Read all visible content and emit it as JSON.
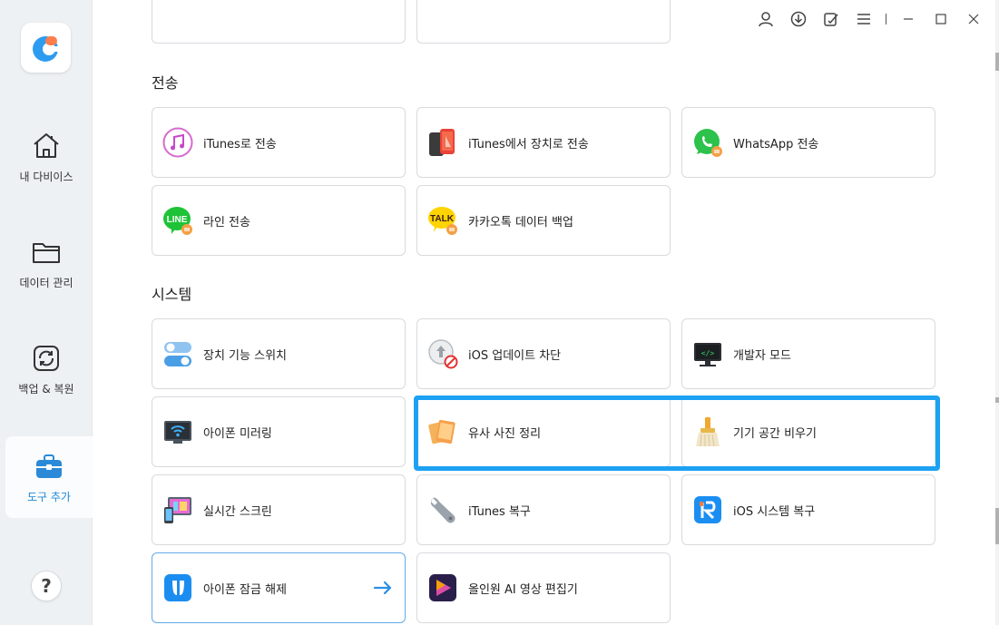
{
  "sidebar": {
    "items": [
      {
        "label": "내 다비이스",
        "icon": "home-icon"
      },
      {
        "label": "데이터 관리",
        "icon": "folder-icon"
      },
      {
        "label": "백업 & 복원",
        "icon": "backup-restore-icon"
      },
      {
        "label": "도구 추가",
        "icon": "toolbox-icon",
        "active": true
      }
    ],
    "help_label": "?"
  },
  "window": {
    "controls": [
      "account-icon",
      "download-icon",
      "feedback-icon",
      "menu-icon",
      "minimize-icon",
      "maximize-icon",
      "close-icon"
    ]
  },
  "sections": {
    "transfer": {
      "title": "전송",
      "cards": [
        {
          "label": "iTunes로 전송",
          "icon": "itunes-icon"
        },
        {
          "label": "iTunes에서 장치로 전송",
          "icon": "itunes-device-icon"
        },
        {
          "label": "WhatsApp 전송",
          "icon": "whatsapp-icon"
        },
        {
          "label": "라인 전송",
          "icon": "line-icon"
        },
        {
          "label": "카카오톡 데이터 백업",
          "icon": "kakaotalk-icon"
        }
      ]
    },
    "system": {
      "title": "시스템",
      "cards": [
        {
          "label": "장치 기능 스위치",
          "icon": "toggle-switch-icon"
        },
        {
          "label": "iOS 업데이트 차단",
          "icon": "update-block-icon"
        },
        {
          "label": "개발자 모드",
          "icon": "developer-icon"
        },
        {
          "label": "아이폰 미러링",
          "icon": "mirroring-icon"
        },
        {
          "label": "유사 사진 정리",
          "icon": "photos-icon"
        },
        {
          "label": "기기 공간 비우기",
          "icon": "broom-icon"
        },
        {
          "label": "실시간 스크린",
          "icon": "realtime-screen-icon"
        },
        {
          "label": "iTunes 복구",
          "icon": "wrench-icon"
        },
        {
          "label": "iOS 시스템 복구",
          "icon": "reiboot-icon"
        },
        {
          "label": "아이폰 잠금 해제",
          "icon": "unlock-icon"
        },
        {
          "label": "올인원 AI 영상 편집기",
          "icon": "ai-video-icon"
        }
      ]
    }
  },
  "colors": {
    "accent": "#1e88d8",
    "highlight": "#1da1f2"
  }
}
